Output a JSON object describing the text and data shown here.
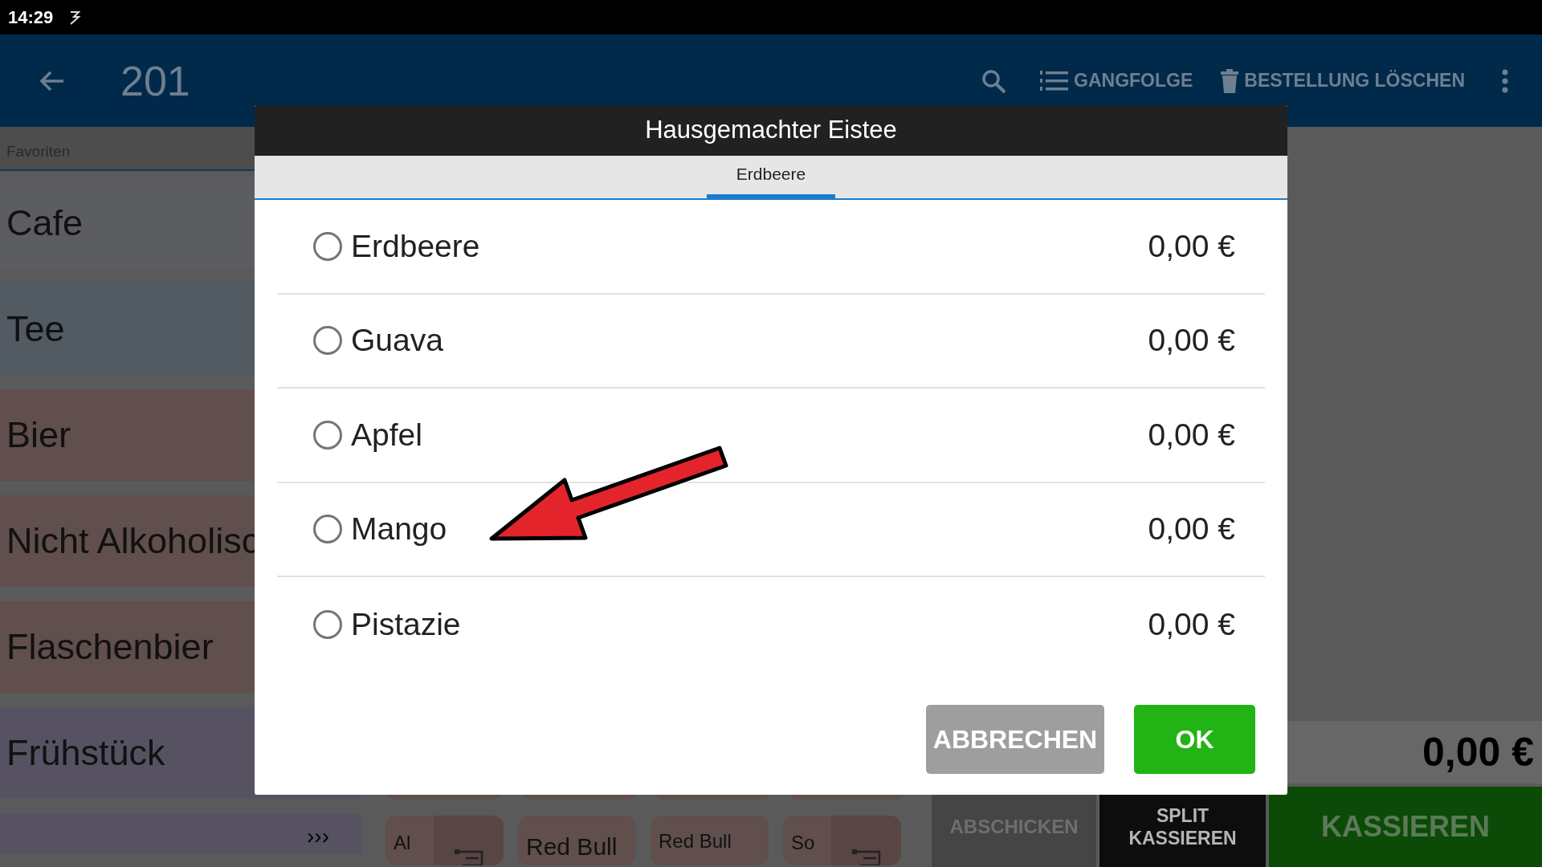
{
  "status_bar": {
    "time": "14:29"
  },
  "app_bar": {
    "title": "201",
    "actions": [
      {
        "label": "GANGFOLGE",
        "kind": "list"
      },
      {
        "label": "BESTELLUNG LÖSCHEN",
        "kind": "trash"
      }
    ]
  },
  "sidebar": {
    "tab": "Favoriten",
    "categories": [
      {
        "label": "Cafe",
        "color": "#5c5d61"
      },
      {
        "label": "Tee",
        "color": "#525a62"
      },
      {
        "label": "Bier",
        "color": "#604f4d"
      },
      {
        "label": "Nicht Alkoholisc",
        "color": "#604f4d"
      },
      {
        "label": "Flaschenbier",
        "color": "#604f4d"
      },
      {
        "label": "Frühstück",
        "color": "#575262"
      },
      {
        "label": "›››",
        "color": "#575262"
      }
    ]
  },
  "products": [
    {
      "label": "Al",
      "kind": "icon"
    },
    {
      "label": "Red Bull",
      "kind": "large"
    },
    {
      "label": "Red Bull",
      "kind": "small"
    },
    {
      "label": "So",
      "kind": "icon"
    }
  ],
  "total": "0,00 €",
  "actions": [
    {
      "label": "ABSCHICKEN",
      "kind": "disabled"
    },
    {
      "label": "SPLIT KASSIEREN",
      "kind": "dark"
    },
    {
      "label": "KASSIEREN",
      "kind": "primary"
    }
  ],
  "dialog": {
    "title": "Hausgemachter Eistee",
    "tabs": [
      {
        "label": "Erdbeere",
        "selected": true
      }
    ],
    "options": [
      {
        "label": "Erdbeere",
        "price": "0,00 €",
        "selected": false
      },
      {
        "label": "Guava",
        "price": "0,00 €",
        "selected": false
      },
      {
        "label": "Apfel",
        "price": "0,00 €",
        "selected": false
      },
      {
        "label": "Mango",
        "price": "0,00 €",
        "selected": false
      },
      {
        "label": "Pistazie",
        "price": "0,00 €",
        "selected": false
      }
    ],
    "buttons": [
      {
        "label": "ABBRECHEN",
        "kind": "secondary"
      },
      {
        "label": "OK",
        "kind": "primary"
      }
    ]
  }
}
